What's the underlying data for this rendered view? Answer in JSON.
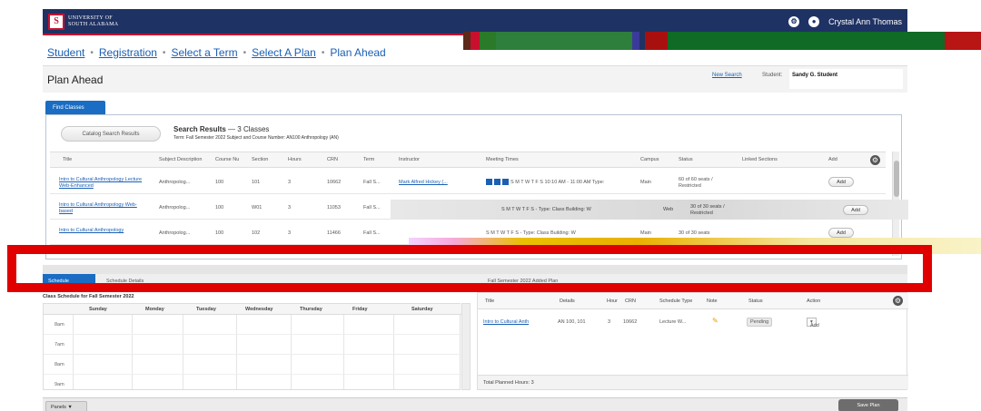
{
  "header": {
    "logo_mark": "S",
    "logo_line1": "UNIVERSITY OF",
    "logo_line2": "SOUTH ALABAMA",
    "help_icon": "gear-icon",
    "user_icon": "user-icon",
    "user_name": "Crystal Ann Thomas"
  },
  "breadcrumb": {
    "items": [
      "Student",
      "Registration",
      "Select a Term",
      "Select A Plan",
      "Plan Ahead"
    ],
    "separator": "•"
  },
  "page": {
    "title": "Plan Ahead",
    "new_search": "New Search",
    "student_label": "Student:",
    "student_name": "Sandy G. Student"
  },
  "tabs": {
    "find_classes": "Find Classes"
  },
  "search": {
    "catalog_button": "Catalog Search Results",
    "results_label": "Search Results",
    "results_count": "— 3 Classes",
    "term_line": "Term: Fall Semester 2022    Subject and Course Number: AN100 Anthropology (AN)"
  },
  "grid": {
    "columns": [
      "Title",
      "Subject Description",
      "Course Nu",
      "Section",
      "Hours",
      "CRN",
      "Term",
      "Instructor",
      "Meeting Times",
      "Campus",
      "Status",
      "Linked Sections",
      "Add"
    ],
    "rows": [
      {
        "title": "Intro to Cultural Anthropology Lecture Web-Enhanced",
        "subject": "Anthropolog...",
        "course": "100",
        "section": "101",
        "hours": "3",
        "crn": "10662",
        "term": "Fall S...",
        "instructor": "Mark Alfred Hickey (...",
        "meeting": "S M T W T F S  10:10 AM - 11:00 AM  Type:",
        "campus": "Main",
        "status": "60 of 60 seats / Restricted",
        "add": "Add"
      },
      {
        "title": "Intro to Cultural Anthropology Web-based",
        "subject": "Anthropolog...",
        "course": "100",
        "section": "W01",
        "hours": "3",
        "crn": "11053",
        "term": "Fall S...",
        "instructor": "",
        "meeting": "S M T W T F S  -  Type: Class  Building: W",
        "campus": "Web",
        "status": "30 of 30 seats / Restricted",
        "add": "Add"
      },
      {
        "title": "Intro to Cultural Anthropology",
        "subject": "Anthropolog...",
        "course": "100",
        "section": "102",
        "hours": "3",
        "crn": "11466",
        "term": "Fall S...",
        "instructor": "",
        "meeting": "S M T W T F S  -  Type: Class  Building: W",
        "campus": "Main",
        "status": "30 of 30 seats",
        "add": "Add"
      }
    ]
  },
  "lower": {
    "active_tab": "Schedule",
    "secondary_tab": "Schedule Details",
    "plan_title": "Fall Semester 2022 Added Plan"
  },
  "schedule": {
    "title": "Class Schedule for Fall Semester 2022",
    "days": [
      "Sunday",
      "Monday",
      "Tuesday",
      "Wednesday",
      "Thursday",
      "Friday",
      "Saturday"
    ],
    "times": [
      "8am",
      "7am",
      "8am",
      "9am"
    ]
  },
  "plan": {
    "columns": [
      "Title",
      "Details",
      "Hour",
      "CRN",
      "Schedule Type",
      "Note",
      "Status",
      "Action"
    ],
    "row": {
      "title": "Intro to Cultural Anth",
      "details": "AN 100, 101",
      "hours": "3",
      "crn": "10662",
      "schedule_type": "Lecture W...",
      "status": "Pending",
      "action": "Add"
    },
    "total": "Total Planned Hours: 3"
  },
  "footer": {
    "panels": "Panels ▼",
    "save": "Save Plan"
  },
  "colors": {
    "navy": "#1f3264",
    "red": "#c8102e",
    "link_blue": "#1a5fb4",
    "tab_blue": "#1a6dc2",
    "highlight_red": "#e10000"
  }
}
